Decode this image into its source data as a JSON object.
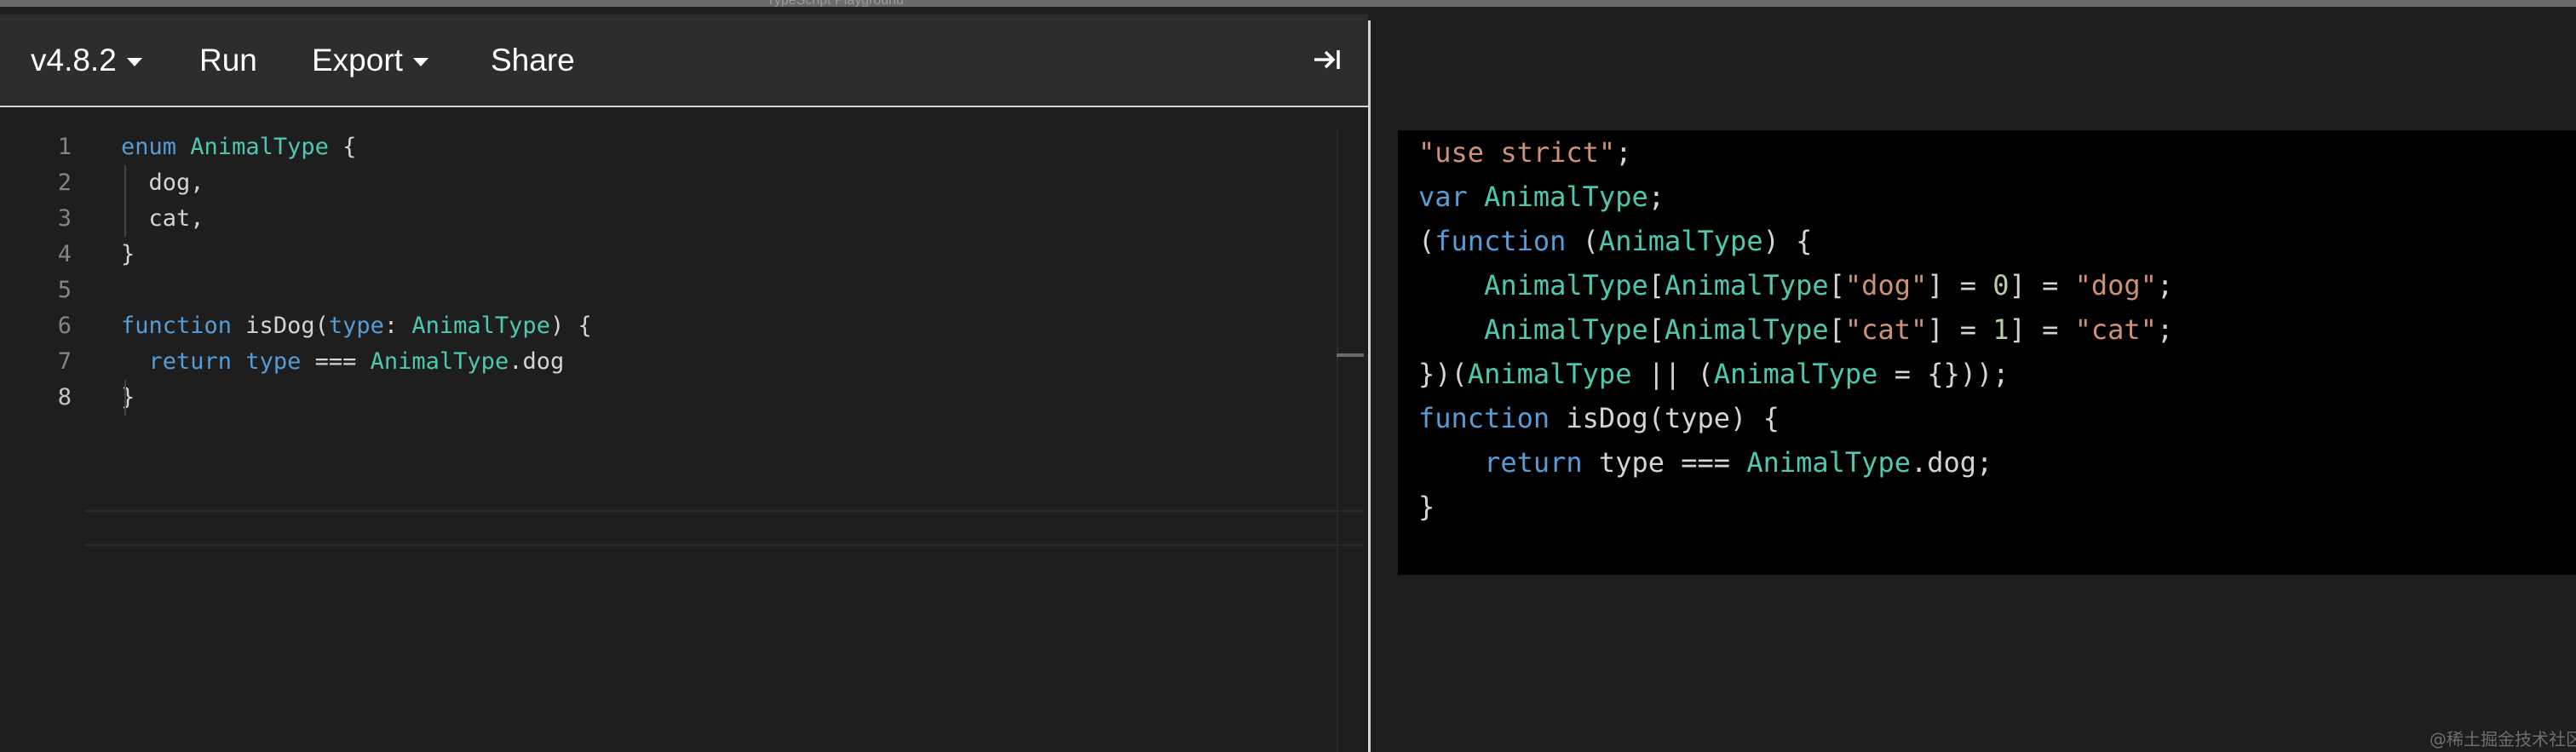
{
  "window": {
    "title": "TypeScript Playground"
  },
  "toolbar": {
    "version_label": "v4.8.2",
    "run_label": "Run",
    "export_label": "Export",
    "share_label": "Share",
    "collapse_icon": "arrow-right-to-bar-icon"
  },
  "editor": {
    "active_line": 8,
    "line_numbers": [
      "1",
      "2",
      "3",
      "4",
      "5",
      "6",
      "7",
      "8"
    ],
    "lines": [
      [
        {
          "t": "enum",
          "c": "kw"
        },
        {
          "t": " ",
          "c": "plain"
        },
        {
          "t": "AnimalType",
          "c": "ty"
        },
        {
          "t": " {",
          "c": "plain"
        }
      ],
      [
        {
          "t": "  dog,",
          "c": "plain"
        }
      ],
      [
        {
          "t": "  cat,",
          "c": "plain"
        }
      ],
      [
        {
          "t": "}",
          "c": "plain"
        }
      ],
      [],
      [
        {
          "t": "function",
          "c": "kw"
        },
        {
          "t": " isDog(",
          "c": "plain"
        },
        {
          "t": "type",
          "c": "kw"
        },
        {
          "t": ": ",
          "c": "plain"
        },
        {
          "t": "AnimalType",
          "c": "ty"
        },
        {
          "t": ") {",
          "c": "plain"
        }
      ],
      [
        {
          "t": "  ",
          "c": "plain"
        },
        {
          "t": "return",
          "c": "kw"
        },
        {
          "t": " ",
          "c": "plain"
        },
        {
          "t": "type",
          "c": "kw"
        },
        {
          "t": " === ",
          "c": "plain"
        },
        {
          "t": "AnimalType",
          "c": "ty"
        },
        {
          "t": ".dog",
          "c": "plain"
        }
      ],
      [
        {
          "t": "}",
          "c": "plain"
        }
      ]
    ]
  },
  "output": {
    "lines": [
      [
        {
          "t": "\"use strict\"",
          "c": "str"
        },
        {
          "t": ";",
          "c": "plain"
        }
      ],
      [
        {
          "t": "var",
          "c": "kw"
        },
        {
          "t": " ",
          "c": "plain"
        },
        {
          "t": "AnimalType",
          "c": "ty"
        },
        {
          "t": ";",
          "c": "plain"
        }
      ],
      [
        {
          "t": "(",
          "c": "plain"
        },
        {
          "t": "function",
          "c": "kw"
        },
        {
          "t": " (",
          "c": "plain"
        },
        {
          "t": "AnimalType",
          "c": "ty"
        },
        {
          "t": ") {",
          "c": "plain"
        }
      ],
      [
        {
          "t": "    ",
          "c": "plain"
        },
        {
          "t": "AnimalType",
          "c": "ty"
        },
        {
          "t": "[",
          "c": "plain"
        },
        {
          "t": "AnimalType",
          "c": "ty"
        },
        {
          "t": "[",
          "c": "plain"
        },
        {
          "t": "\"dog\"",
          "c": "str"
        },
        {
          "t": "] = ",
          "c": "plain"
        },
        {
          "t": "0",
          "c": "num"
        },
        {
          "t": "] = ",
          "c": "plain"
        },
        {
          "t": "\"dog\"",
          "c": "str"
        },
        {
          "t": ";",
          "c": "plain"
        }
      ],
      [
        {
          "t": "    ",
          "c": "plain"
        },
        {
          "t": "AnimalType",
          "c": "ty"
        },
        {
          "t": "[",
          "c": "plain"
        },
        {
          "t": "AnimalType",
          "c": "ty"
        },
        {
          "t": "[",
          "c": "plain"
        },
        {
          "t": "\"cat\"",
          "c": "str"
        },
        {
          "t": "] = ",
          "c": "plain"
        },
        {
          "t": "1",
          "c": "num"
        },
        {
          "t": "] = ",
          "c": "plain"
        },
        {
          "t": "\"cat\"",
          "c": "str"
        },
        {
          "t": ";",
          "c": "plain"
        }
      ],
      [
        {
          "t": "})(",
          "c": "plain"
        },
        {
          "t": "AnimalType",
          "c": "ty"
        },
        {
          "t": " || (",
          "c": "plain"
        },
        {
          "t": "AnimalType",
          "c": "ty"
        },
        {
          "t": " = {}));",
          "c": "plain"
        }
      ],
      [
        {
          "t": "function",
          "c": "kw"
        },
        {
          "t": " isDog(type) {",
          "c": "plain"
        }
      ],
      [
        {
          "t": "    ",
          "c": "plain"
        },
        {
          "t": "return",
          "c": "kw"
        },
        {
          "t": " type === ",
          "c": "plain"
        },
        {
          "t": "AnimalType",
          "c": "ty"
        },
        {
          "t": ".dog;",
          "c": "plain"
        }
      ],
      [
        {
          "t": "}",
          "c": "plain"
        }
      ]
    ]
  },
  "watermark": "@稀土掘金技术社区",
  "colors": {
    "keyword": "#569cd6",
    "type": "#4ec9b0",
    "string": "#ce9178",
    "number": "#b5cea8",
    "text": "#d4d4d4",
    "toolbar_bg": "#2d2d2d",
    "editor_bg": "#1e1e1e",
    "output_bg": "#000000"
  }
}
